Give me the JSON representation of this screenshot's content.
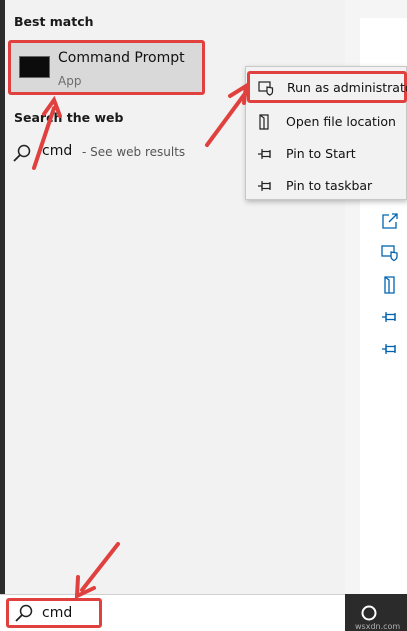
{
  "best_match": {
    "title": "Best match",
    "item_title": "Command Prompt",
    "item_subtitle": "App",
    "icon": "command-prompt-icon"
  },
  "web": {
    "title": "Search the web",
    "query": "cmd",
    "suffix": "- See web results",
    "icon": "search-icon"
  },
  "context_menu": {
    "items": [
      {
        "label": "Run as administrator",
        "icon": "shield-icon"
      },
      {
        "label": "Open file location",
        "icon": "file-location-icon"
      },
      {
        "label": "Pin to Start",
        "icon": "pin-icon"
      },
      {
        "label": "Pin to taskbar",
        "icon": "pin-icon"
      }
    ]
  },
  "side_actions": [
    "open-icon",
    "shield-icon",
    "file-location-icon",
    "pin-icon",
    "pin-icon"
  ],
  "search": {
    "value": "cmd",
    "icon": "search-icon"
  },
  "watermark": "wsxdn.com",
  "colors": {
    "highlight": "#e0413e",
    "accent": "#0063b1",
    "panel": "#f2f2f2"
  }
}
